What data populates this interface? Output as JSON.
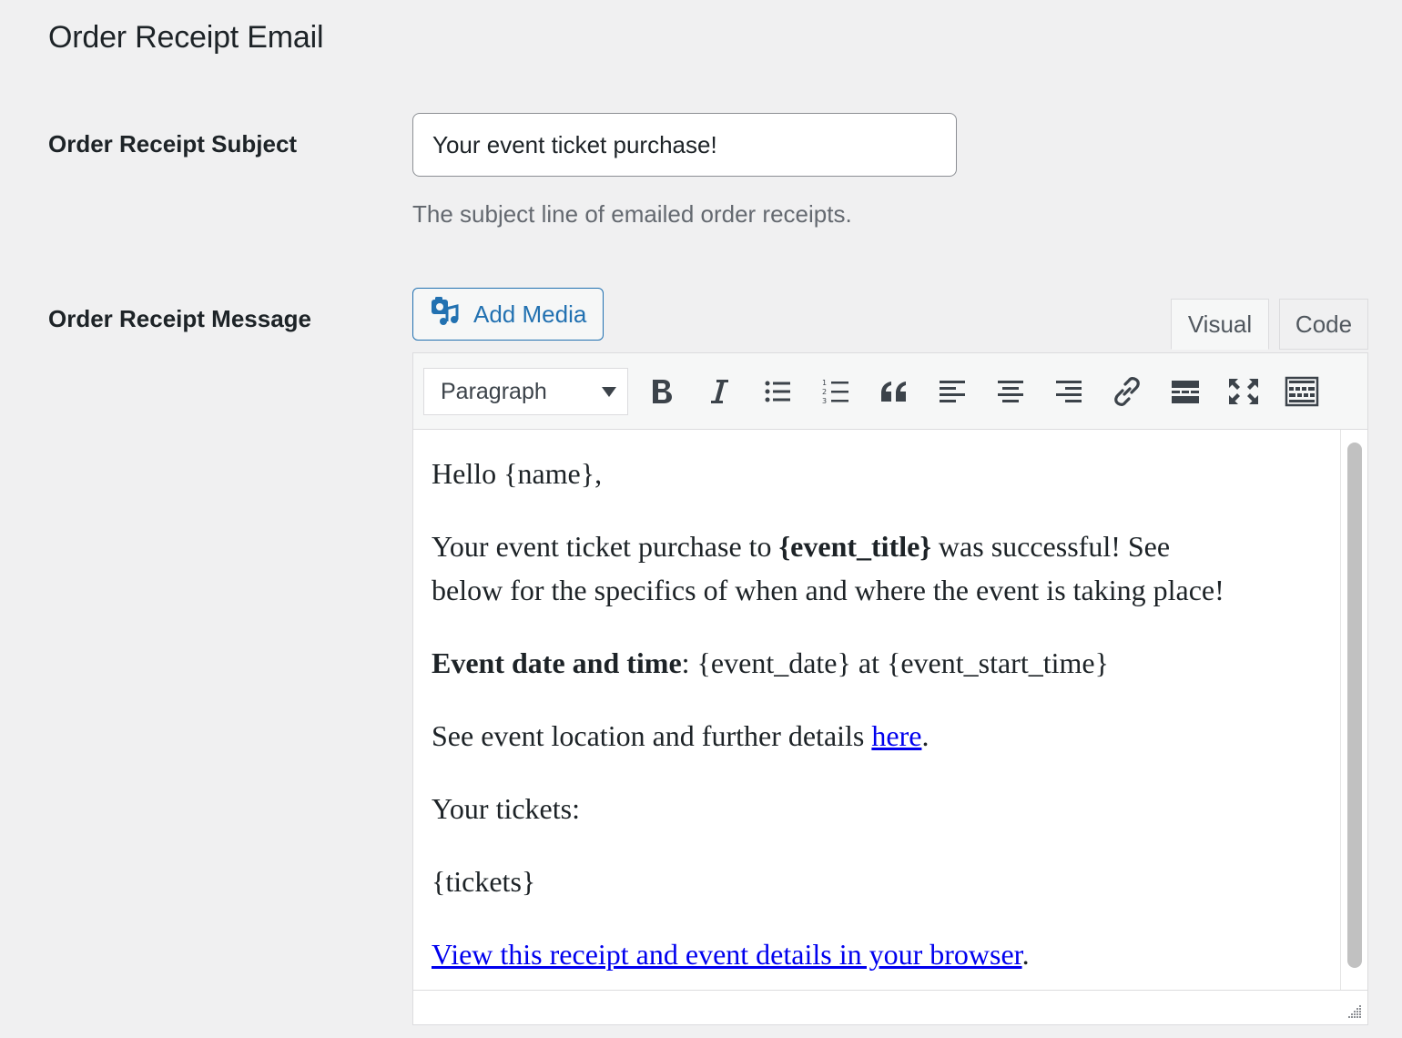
{
  "section": {
    "title": "Order Receipt Email"
  },
  "subject": {
    "label": "Order Receipt Subject",
    "value": "Your event ticket purchase!",
    "description": "The subject line of emailed order receipts."
  },
  "message": {
    "label": "Order Receipt Message",
    "add_media_label": "Add Media",
    "tabs": {
      "visual": "Visual",
      "code": "Code"
    },
    "active_tab": "Visual",
    "toolbar": {
      "format_select": "Paragraph",
      "buttons": [
        "bold",
        "italic",
        "bulleted-list",
        "numbered-list",
        "blockquote",
        "align-left",
        "align-center",
        "align-right",
        "insert-link",
        "read-more",
        "fullscreen",
        "toolbar-toggle"
      ]
    },
    "body": {
      "p1": "Hello {name},",
      "p2_a": "Your event ticket purchase to ",
      "p2_bold": "{event_title}",
      "p2_b": " was successful! See",
      "p2_c": "below for the specifics of when and where the event is taking place!",
      "p3_bold": "Event date and time",
      "p3_rest": ": {event_date} at {event_start_time}",
      "p4_a": "See event location and further details ",
      "p4_link": "here",
      "p4_end": ".",
      "p5": "Your tickets:",
      "p6": "{tickets}",
      "p7_link": "View this receipt and event details in your browser",
      "p7_end": "."
    }
  },
  "colors": {
    "background": "#f0f0f1",
    "accent": "#2271b1",
    "link": "#0000ee",
    "muted_text": "#646970"
  }
}
